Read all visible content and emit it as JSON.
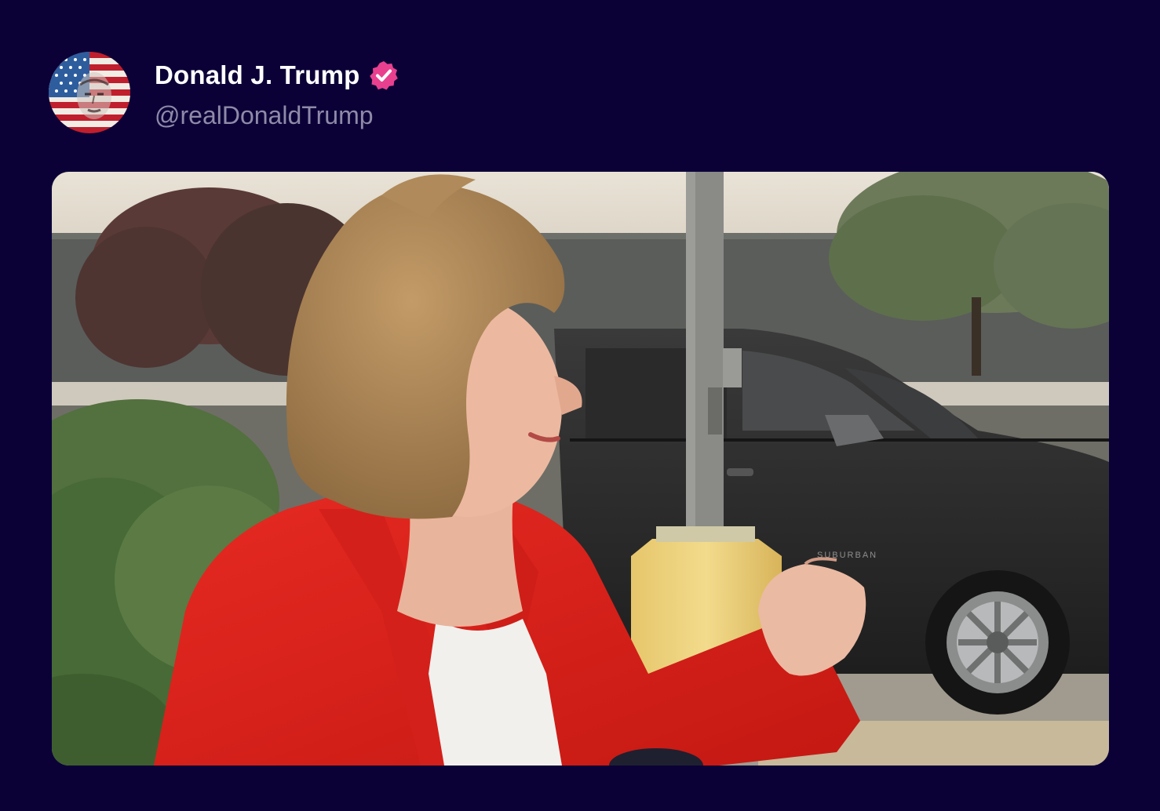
{
  "post": {
    "author": {
      "display_name": "Donald J. Trump",
      "handle": "@realDonaldTrump",
      "verified": true,
      "avatar_icon": "american-flag-portrait-avatar",
      "verified_icon": "verified-badge-icon"
    },
    "media": {
      "type": "video-frame",
      "vehicle_badge_text": "SUBURBAN"
    }
  },
  "colors": {
    "background": "#0b0137",
    "name_text": "#ffffff",
    "handle_text": "#8f8aa8",
    "verified_badge": "#e8408f"
  }
}
